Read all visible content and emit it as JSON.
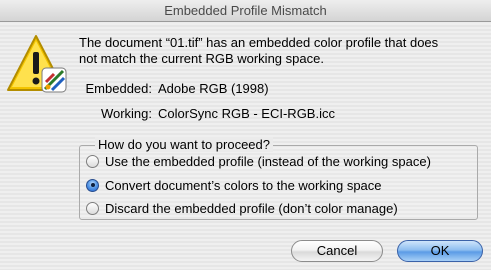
{
  "window": {
    "title": "Embedded Profile Mismatch"
  },
  "alert": {
    "icon": "caution-triangle-with-colorsync-icon",
    "message_line1": "The document “01.tif” has an embedded color profile that does",
    "message_line2": "not match the current RGB working space."
  },
  "profiles": {
    "embedded_label": "Embedded:",
    "embedded_value": "Adobe RGB (1998)",
    "working_label": "Working:",
    "working_value": "ColorSync RGB - ECI-RGB.icc"
  },
  "options": {
    "title": "How do you want to proceed?",
    "items": [
      {
        "label": "Use the embedded profile (instead of the working space)",
        "selected": false
      },
      {
        "label": "Convert document’s colors to the working space",
        "selected": true
      },
      {
        "label": "Discard the embedded profile (don’t color manage)",
        "selected": false
      }
    ]
  },
  "buttons": {
    "cancel": "Cancel",
    "ok": "OK"
  },
  "colors": {
    "default_button": "#5b9be6",
    "radio_selected": "#1b5fcf",
    "warning_yellow": "#f4c400"
  }
}
